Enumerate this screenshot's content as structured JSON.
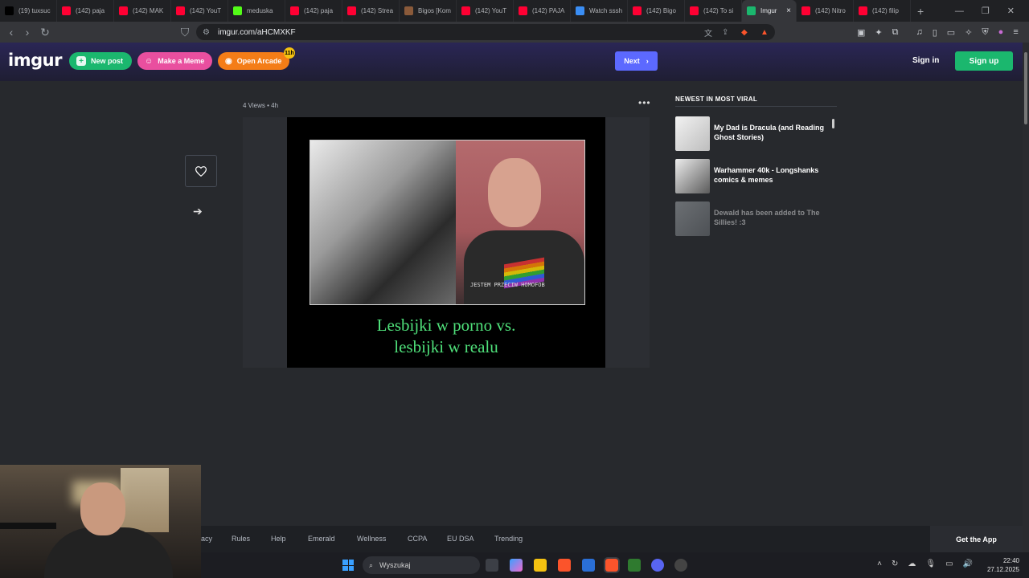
{
  "browser": {
    "tabs": [
      {
        "label": "(19) tuxsuc",
        "icon": "x-icon",
        "color": "#000000"
      },
      {
        "label": "(142) paja",
        "icon": "youtube-icon",
        "color": "#ff0033"
      },
      {
        "label": "(142) MAK",
        "icon": "youtube-icon",
        "color": "#ff0033"
      },
      {
        "label": "(142) YouT",
        "icon": "youtube-icon",
        "color": "#ff0033"
      },
      {
        "label": "meduska",
        "icon": "kick-icon",
        "color": "#53fc18"
      },
      {
        "label": "(142) paja",
        "icon": "youtube-icon",
        "color": "#ff0033"
      },
      {
        "label": "(142) Strea",
        "icon": "youtube-icon",
        "color": "#ff0033"
      },
      {
        "label": "Bigos [Kom",
        "icon": "bigos-icon",
        "color": "#8a5a3a"
      },
      {
        "label": "(142) YouT",
        "icon": "youtube-icon",
        "color": "#ff0033"
      },
      {
        "label": "(142) PAJA",
        "icon": "youtube-icon",
        "color": "#ff0033"
      },
      {
        "label": "Watch sssh",
        "icon": "watch-icon",
        "color": "#3a8ef5"
      },
      {
        "label": "(142) Bigo",
        "icon": "youtube-icon",
        "color": "#ff0033"
      },
      {
        "label": "(142) To si",
        "icon": "youtube-icon",
        "color": "#ff0033"
      },
      {
        "label": "Imgur",
        "icon": "imgur-icon",
        "color": "#1bb76e",
        "active": true
      },
      {
        "label": "(142) Nitro",
        "icon": "youtube-icon",
        "color": "#ff0033"
      },
      {
        "label": "(142) filip",
        "icon": "youtube-icon",
        "color": "#ff0033"
      }
    ],
    "url": "imgur.com/aHCMXKF"
  },
  "header": {
    "logo": "imgur",
    "new_post": "New post",
    "make_meme": "Make a Meme",
    "open_arcade": "Open Arcade",
    "arcade_badge": "11h",
    "next": "Next",
    "sign_in": "Sign in",
    "sign_up": "Sign up"
  },
  "post": {
    "meta": "4 Views • 4h",
    "caption_line1": "Lesbijki w porno vs.",
    "caption_line2": "lesbijki w realu",
    "shirt_text": "JESTEM PRZECIW HOMOFOB"
  },
  "sidebar": {
    "heading": "NEWEST IN MOST VIRAL",
    "items": [
      {
        "title": "My Dad is Dracula (and Reading Ghost Stories)"
      },
      {
        "title": "Warhammer 40k - Longshanks comics & memes"
      },
      {
        "title": "Dewald has been added to The Sillies! :3"
      }
    ]
  },
  "footer": {
    "links": [
      "acy",
      "Rules",
      "Help",
      "Emerald",
      "Wellness",
      "CCPA",
      "EU DSA",
      "Trending"
    ],
    "get_app": "Get the App"
  },
  "taskbar": {
    "search_placeholder": "Wyszukaj",
    "time": "22:40",
    "date": "27.12.2025"
  },
  "colors": {
    "imgur_green": "#1bb76e",
    "meme_pink": "#e94f9f",
    "arcade_orange": "#f47d17",
    "next_blue": "#5c69ff",
    "caption_green": "#4fe07a"
  }
}
